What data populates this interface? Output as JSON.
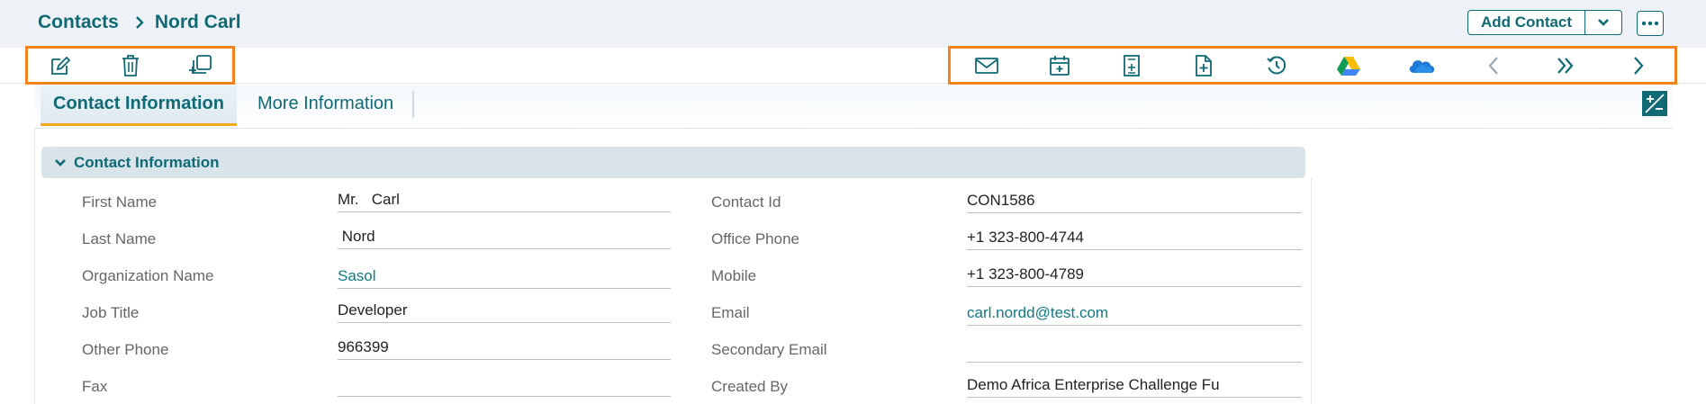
{
  "breadcrumb": {
    "root": "Contacts",
    "current": "Nord Carl"
  },
  "header": {
    "add_contact_label": "Add Contact"
  },
  "toolbar": {
    "left": [
      "edit-icon",
      "trash-icon",
      "duplicate-icon"
    ],
    "right": [
      "mail-icon",
      "calendar-add-icon",
      "document-icon",
      "file-add-icon",
      "history-icon",
      "google-drive-icon",
      "onedrive-icon",
      "chevron-left-icon",
      "double-chevron-right-icon",
      "chevron-right-icon"
    ]
  },
  "tabs": [
    {
      "label": "Contact Information",
      "active": true
    },
    {
      "label": "More Information",
      "active": false
    }
  ],
  "section": {
    "title": "Contact Information"
  },
  "fields_left": [
    {
      "label": "First Name",
      "value": "Mr.   Carl",
      "link": false
    },
    {
      "label": "Last Name",
      "value": " Nord",
      "link": false
    },
    {
      "label": "Organization Name",
      "value": "Sasol",
      "link": true
    },
    {
      "label": "Job Title",
      "value": "Developer",
      "link": false
    },
    {
      "label": "Other Phone",
      "value": "966399",
      "link": false
    },
    {
      "label": "Fax",
      "value": "",
      "link": false
    }
  ],
  "fields_right": [
    {
      "label": "Contact Id",
      "value": "CON1586",
      "link": false
    },
    {
      "label": "Office Phone",
      "value": "+1 323-800-4744",
      "link": false
    },
    {
      "label": "Mobile",
      "value": "+1 323-800-4789",
      "link": false
    },
    {
      "label": "Email",
      "value": "carl.nordd@test.com",
      "link": true
    },
    {
      "label": "Secondary Email",
      "value": "",
      "link": false
    },
    {
      "label": "Created By",
      "value": "Demo Africa Enterprise Challenge Fu",
      "link": false
    }
  ],
  "colors": {
    "primary": "#0e6a75",
    "highlight": "#f58220",
    "tab_underline": "#f5a623",
    "section_bg": "#d8e3ea",
    "header_bg": "#eef2f6"
  }
}
